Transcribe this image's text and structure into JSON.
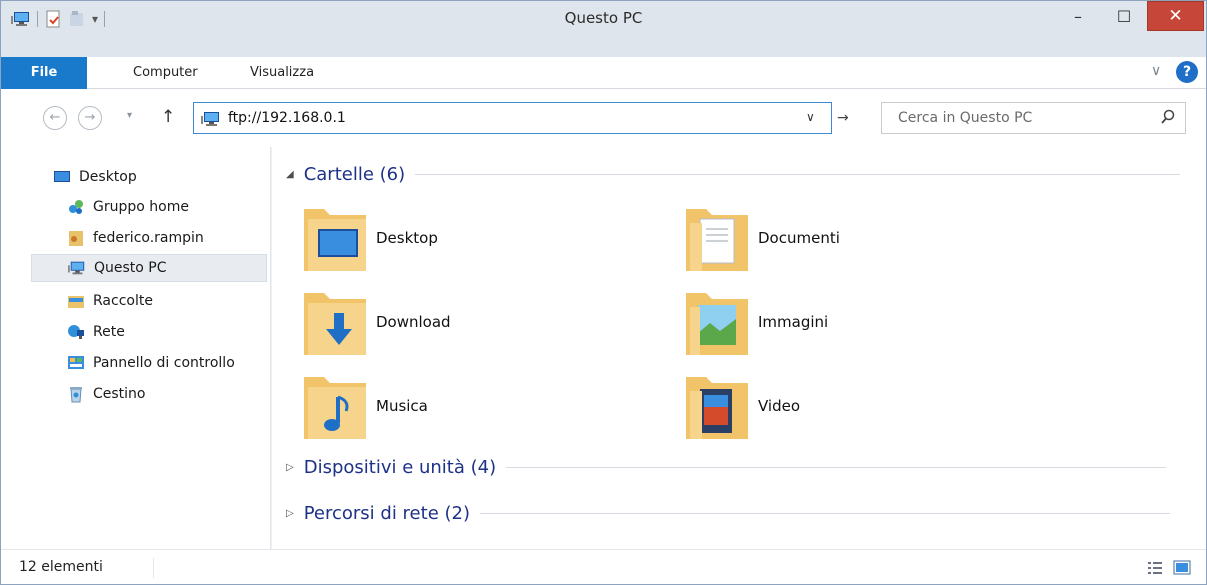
{
  "window": {
    "title": "Questo PC"
  },
  "window_controls": {
    "minimize": "–",
    "maximize": "☐",
    "close": "✕"
  },
  "ribbon": {
    "file": "File",
    "computer": "Computer",
    "view": "Visualizza",
    "collapse": "∨",
    "help": "?"
  },
  "address": {
    "path": "ftp://192.168.0.1",
    "dropdown": "∨",
    "go": "→"
  },
  "search": {
    "placeholder": "Cerca in Questo PC",
    "icon": "search-icon"
  },
  "nav_buttons": {
    "back": "←",
    "forward": "→",
    "recent": "▾",
    "up": "↑"
  },
  "sidebar": {
    "items": [
      {
        "label": "Desktop",
        "icon": "desktop-icon"
      },
      {
        "label": "Gruppo home",
        "icon": "homegroup-icon"
      },
      {
        "label": "federico.rampin",
        "icon": "user-folder-icon"
      },
      {
        "label": "Questo PC",
        "icon": "computer-icon",
        "selected": true
      },
      {
        "label": "Raccolte",
        "icon": "libraries-icon"
      },
      {
        "label": "Rete",
        "icon": "network-icon"
      },
      {
        "label": "Pannello di controllo",
        "icon": "control-panel-icon"
      },
      {
        "label": "Cestino",
        "icon": "recycle-bin-icon"
      }
    ]
  },
  "groups": [
    {
      "title": "Cartelle (6)",
      "expanded": true
    },
    {
      "title": "Dispositivi e unità (4)",
      "expanded": false
    },
    {
      "title": "Percorsi di rete (2)",
      "expanded": false
    }
  ],
  "folders": [
    {
      "label": "Desktop",
      "icon": "desktop-folder-icon"
    },
    {
      "label": "Documenti",
      "icon": "documents-folder-icon"
    },
    {
      "label": "Download",
      "icon": "downloads-folder-icon"
    },
    {
      "label": "Immagini",
      "icon": "pictures-folder-icon"
    },
    {
      "label": "Musica",
      "icon": "music-folder-icon"
    },
    {
      "label": "Video",
      "icon": "videos-folder-icon"
    }
  ],
  "status": {
    "count": "12 elementi"
  },
  "colors": {
    "accent": "#1979ca",
    "group_header": "#1e3287",
    "close": "#c7463a",
    "selection": "#e8ecf1"
  }
}
